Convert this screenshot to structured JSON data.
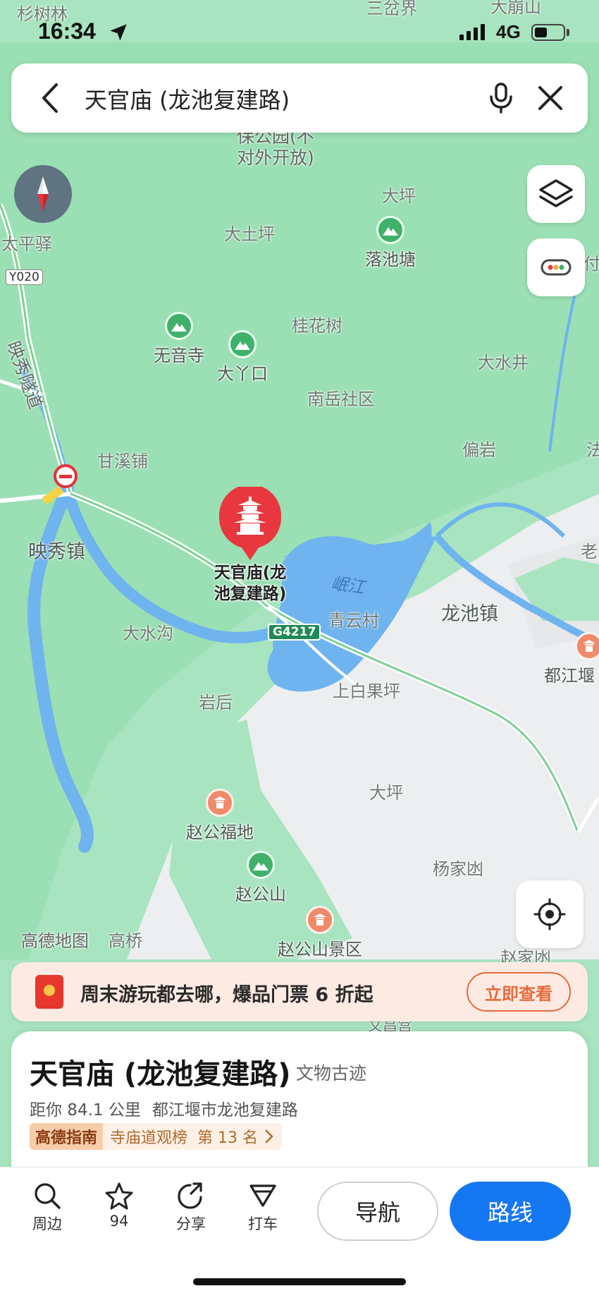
{
  "status_bar": {
    "time": "16:34",
    "network": "4G"
  },
  "search": {
    "query": "天官庙 (龙池复建路)"
  },
  "map": {
    "labels": {
      "shanshulin": "杉树林",
      "sanchajie": "三岔界",
      "dabengshan": "大崩山",
      "duiwai_line1": "保公园(不",
      "duiwai_line2": "对外开放)",
      "taipingyi": "太平驿",
      "road_y020": "Y020",
      "daping_top": "大坪",
      "datuping": "大土坪",
      "guihuashu": "桂花树",
      "dashuijing": "大水井",
      "nanyue": "南岳社区",
      "pianyan": "偏岩",
      "yingxiu_tunnel": "映秀隧道",
      "ganxipu": "甘溪铺",
      "yingxiu_town": "映秀镇",
      "dashuigou": "大水沟",
      "minjiang": "岷江",
      "qingyun": "青云村",
      "longchi_town": "龙池镇",
      "road_g4217": "G4217",
      "yanhou": "岩后",
      "shangbaiguoping": "上白果坪",
      "daping_mid": "大坪",
      "yangjiaao": "杨家凼",
      "gaoqiao": "高桥",
      "zhaojiaao": "赵家凼",
      "wenchang": "文昌宫",
      "lao": "老",
      "fa": "法",
      "fu": "付",
      "amap_brand": "高德地图"
    },
    "pois": {
      "luochitang": "落池塘",
      "wuyinsi": "无音寺",
      "dayakou": "大丫口",
      "zhaogongfudi": "赵公福地",
      "zhaogongshan": "赵公山",
      "zhaogongshan_scenic": "赵公山景区",
      "dujiangyan": "都江堰",
      "selected_line1": "天官庙(龙",
      "selected_line2": "池复建路)"
    }
  },
  "banner": {
    "text": "周末游玩都去哪，爆品门票 6 折起",
    "button": "立即查看"
  },
  "place": {
    "title": "天官庙 (龙池复建路)",
    "category": "文物古迹",
    "distance": "距你 84.1 公里",
    "address": "都江堰市龙池复建路",
    "guide_brand": "高德指南",
    "guide_list": "寺庙道观榜",
    "guide_rank": "第 13 名"
  },
  "toolbar": {
    "nearby": "周边",
    "favorites": "94",
    "share": "分享",
    "taxi": "打车",
    "navigate": "导航",
    "route": "路线"
  },
  "colors": {
    "map_green": "#a8e4bf",
    "map_forest": "#8fdcac",
    "water": "#6fb3ef",
    "selected_pin": "#e8373e",
    "route_button": "#1677f2",
    "banner_accent": "#e8693b"
  }
}
